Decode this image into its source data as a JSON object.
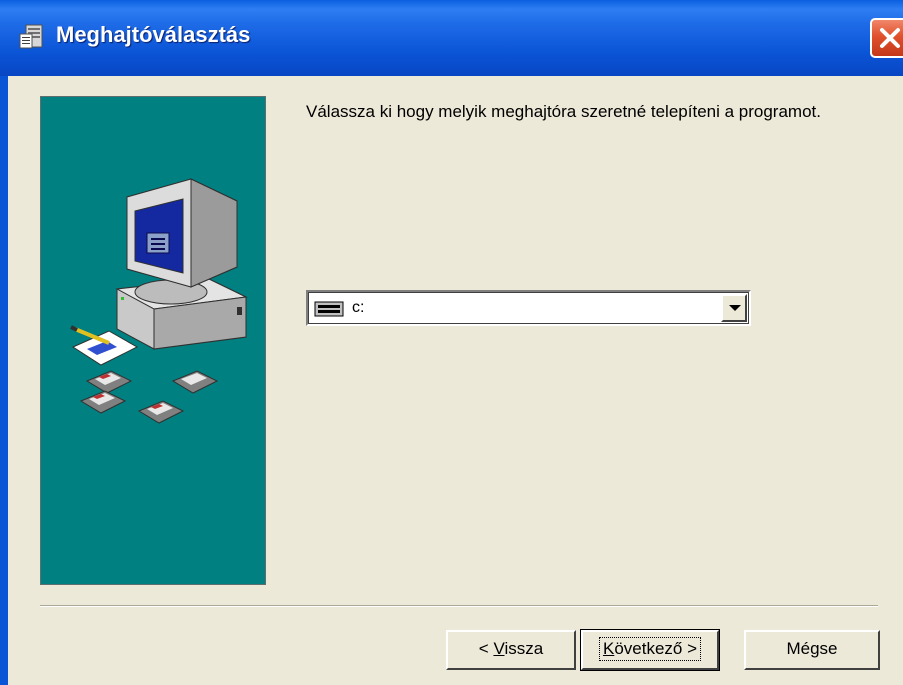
{
  "window": {
    "title": "Meghajtóválasztás",
    "title_color": "#0a54d6",
    "background": "#ece9d8"
  },
  "side_panel": {
    "background": "#008080"
  },
  "main": {
    "instruction": "Válassza ki hogy melyik meghajtóra szeretné telepíteni a programot."
  },
  "drive_select": {
    "icon": "drive-icon",
    "value": "c:"
  },
  "buttons": {
    "back": {
      "prefix": "< ",
      "accel": "V",
      "rest": "issza"
    },
    "next": {
      "accel": "K",
      "rest": "övetkező >"
    },
    "cancel": "Mégse"
  }
}
